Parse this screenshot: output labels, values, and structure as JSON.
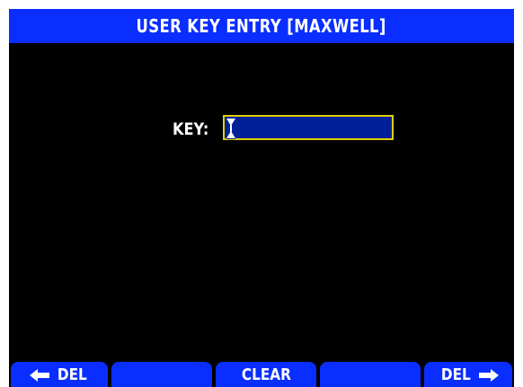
{
  "title": "USER KEY ENTRY [MAXWELL]",
  "key_field": {
    "label": "KEY:",
    "value": ""
  },
  "soft_keys": [
    {
      "label": "DEL",
      "icon": "arrow-left-icon"
    },
    {
      "label": ""
    },
    {
      "label": "CLEAR"
    },
    {
      "label": ""
    },
    {
      "label": "DEL",
      "icon": "arrow-right-icon"
    }
  ],
  "colors": {
    "title_bar": "#0a2eff",
    "screen_background": "#000000",
    "input_background": "#00209a",
    "input_border": "#e0d000",
    "text": "#ffffff"
  }
}
